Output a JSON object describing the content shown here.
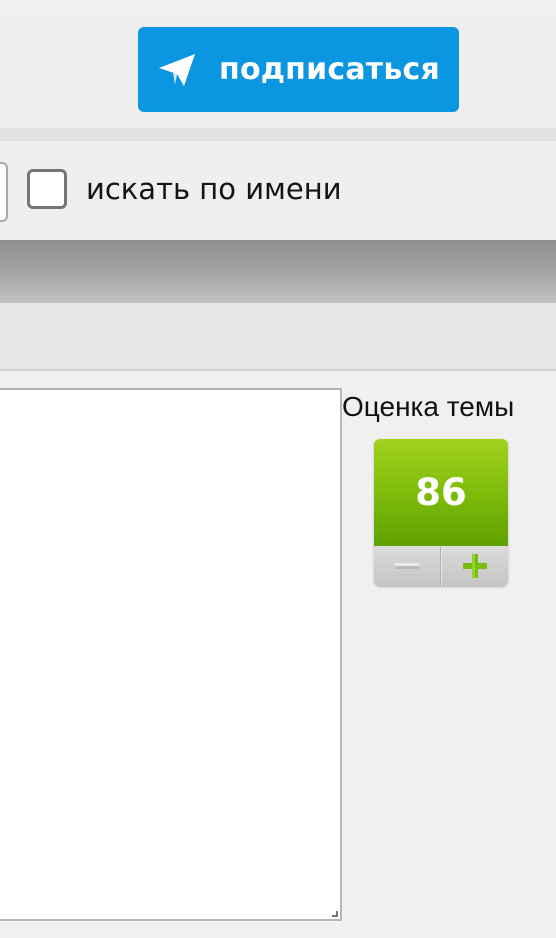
{
  "subscribe": {
    "label": "подписаться",
    "icon": "telegram-icon",
    "color": "#0a96e0"
  },
  "search": {
    "checkbox_label": "искать по имени",
    "checked": false
  },
  "rating": {
    "title": "Оценка темы",
    "score": "86",
    "minus_icon": "minus-icon",
    "plus_icon": "plus-icon",
    "score_color": "#7cba0a"
  },
  "message": {
    "value": ""
  }
}
